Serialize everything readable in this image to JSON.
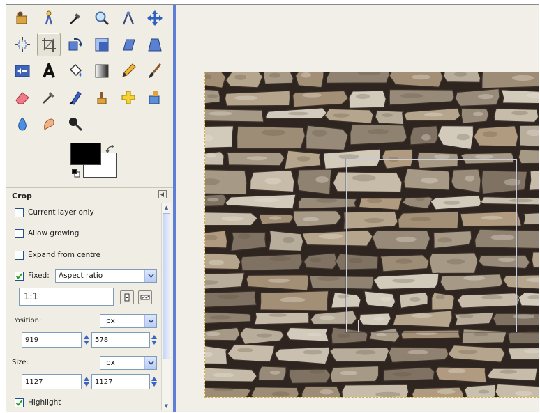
{
  "toolbox": {
    "tools": [
      {
        "name": "rect-select-icon",
        "active": false
      },
      {
        "name": "fuzzy-select-icon",
        "active": false
      },
      {
        "name": "color-picker-icon",
        "active": false
      },
      {
        "name": "zoom-icon",
        "active": false
      },
      {
        "name": "measure-icon",
        "active": false
      },
      {
        "name": "move-icon",
        "active": false
      },
      {
        "name": "align-icon",
        "active": false
      },
      {
        "name": "crop-icon",
        "active": true
      },
      {
        "name": "rotate-icon",
        "active": false
      },
      {
        "name": "scale-icon",
        "active": false
      },
      {
        "name": "shear-icon",
        "active": false
      },
      {
        "name": "perspective-icon",
        "active": false
      },
      {
        "name": "flip-icon",
        "active": false
      },
      {
        "name": "text-icon",
        "active": false
      },
      {
        "name": "bucket-fill-icon",
        "active": false
      },
      {
        "name": "blend-icon",
        "active": false
      },
      {
        "name": "pencil-icon",
        "active": false
      },
      {
        "name": "paintbrush-icon",
        "active": false
      },
      {
        "name": "eraser-icon",
        "active": false
      },
      {
        "name": "airbrush-icon",
        "active": false
      },
      {
        "name": "ink-icon",
        "active": false
      },
      {
        "name": "clone-icon",
        "active": false
      },
      {
        "name": "heal-icon",
        "active": false
      },
      {
        "name": "perspective-clone-icon",
        "active": false
      },
      {
        "name": "blur-sharpen-icon",
        "active": false
      },
      {
        "name": "smudge-icon",
        "active": false
      },
      {
        "name": "dodge-burn-icon",
        "active": false
      }
    ],
    "colors": {
      "foreground": "#000000",
      "background": "#ffffff"
    }
  },
  "tool_options": {
    "title": "Crop",
    "current_layer_only": {
      "label": "Current layer only",
      "checked": false
    },
    "allow_growing": {
      "label": "Allow growing",
      "checked": false
    },
    "expand_from_centre": {
      "label": "Expand from centre",
      "checked": false
    },
    "fixed": {
      "label": "Fixed:",
      "checked": true,
      "mode": "Aspect ratio"
    },
    "ratio_value": "1:1",
    "position": {
      "label": "Position:",
      "unit": "px",
      "x": "919",
      "y": "578"
    },
    "size": {
      "label": "Size:",
      "unit": "px",
      "width": "1127",
      "height": "1127"
    },
    "highlight": {
      "label": "Highlight",
      "checked": true
    }
  },
  "canvas": {
    "image_subject": "stone-wall-photo",
    "crop_selection_width_fraction": 0.51,
    "crop_selection_height_fraction": 0.53
  },
  "theme": {
    "accent": "#5d7fd6",
    "checkbox_border": "#1d5291",
    "check_color": "#21a121"
  }
}
